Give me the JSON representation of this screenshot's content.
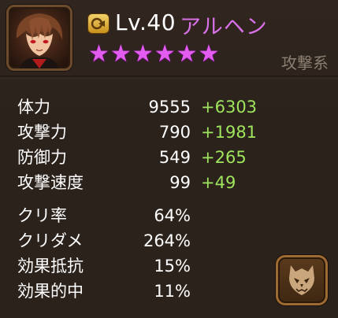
{
  "header": {
    "level": "Lv.40",
    "name": "アルヘン",
    "stars": [
      "★",
      "★",
      "★",
      "★",
      "★",
      "★"
    ],
    "type": "攻撃系"
  },
  "base_stats": [
    {
      "label": "体力",
      "value": "9555",
      "bonus": "+6303"
    },
    {
      "label": "攻撃力",
      "value": "790",
      "bonus": "+1981"
    },
    {
      "label": "防御力",
      "value": "549",
      "bonus": "+265"
    },
    {
      "label": "攻撃速度",
      "value": "99",
      "bonus": "+49"
    }
  ],
  "extra_stats": [
    {
      "label": "クリ率",
      "value": "64%"
    },
    {
      "label": "クリダメ",
      "value": "264%"
    },
    {
      "label": "効果抵抗",
      "value": "15%"
    },
    {
      "label": "効果的中",
      "value": "11%"
    }
  ],
  "colors": {
    "name": "#d871e8",
    "stars": "#e35cf0",
    "bonus": "#9fe55d",
    "type": "#8c7e70"
  },
  "icons": {
    "portrait": "monster-portrait",
    "badge": "level-badge-icon",
    "monster_button": "monster-mask-icon"
  }
}
